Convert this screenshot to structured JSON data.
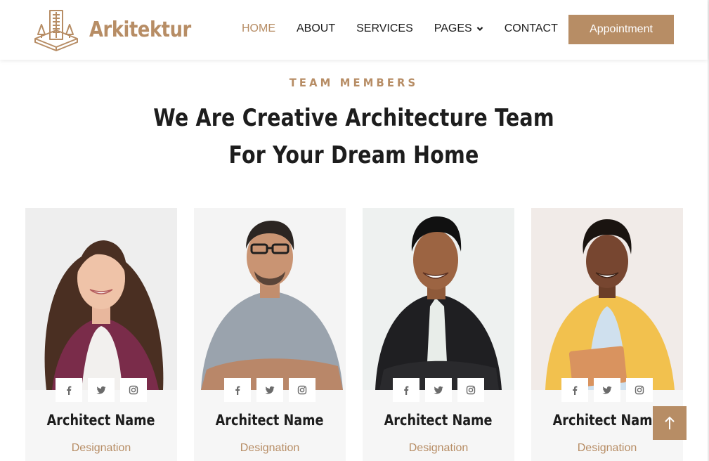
{
  "brand": {
    "name": "Arkitektur",
    "logo_icon": "building-logo-icon"
  },
  "nav": {
    "items": [
      {
        "label": "HOME",
        "active": true
      },
      {
        "label": "ABOUT",
        "active": false
      },
      {
        "label": "SERVICES",
        "active": false
      },
      {
        "label": "PAGES",
        "active": false,
        "has_dropdown": true
      },
      {
        "label": "CONTACT",
        "active": false
      }
    ],
    "cta_label": "Appointment"
  },
  "team": {
    "eyebrow": "TEAM MEMBERS",
    "headline_line1": "We Are Creative Architecture Team",
    "headline_line2": "For Your Dream Home",
    "members": [
      {
        "name": "Architect Name",
        "role": "Designation"
      },
      {
        "name": "Architect Name",
        "role": "Designation"
      },
      {
        "name": "Architect Name",
        "role": "Designation"
      },
      {
        "name": "Architect Name",
        "role": "Designation"
      }
    ],
    "social_icons": [
      "facebook-icon",
      "twitter-icon",
      "instagram-icon"
    ]
  },
  "colors": {
    "accent": "#b78d65",
    "text": "#1d1d1d",
    "card_bg": "#f6f6f6"
  },
  "back_to_top_icon": "arrow-up-icon"
}
